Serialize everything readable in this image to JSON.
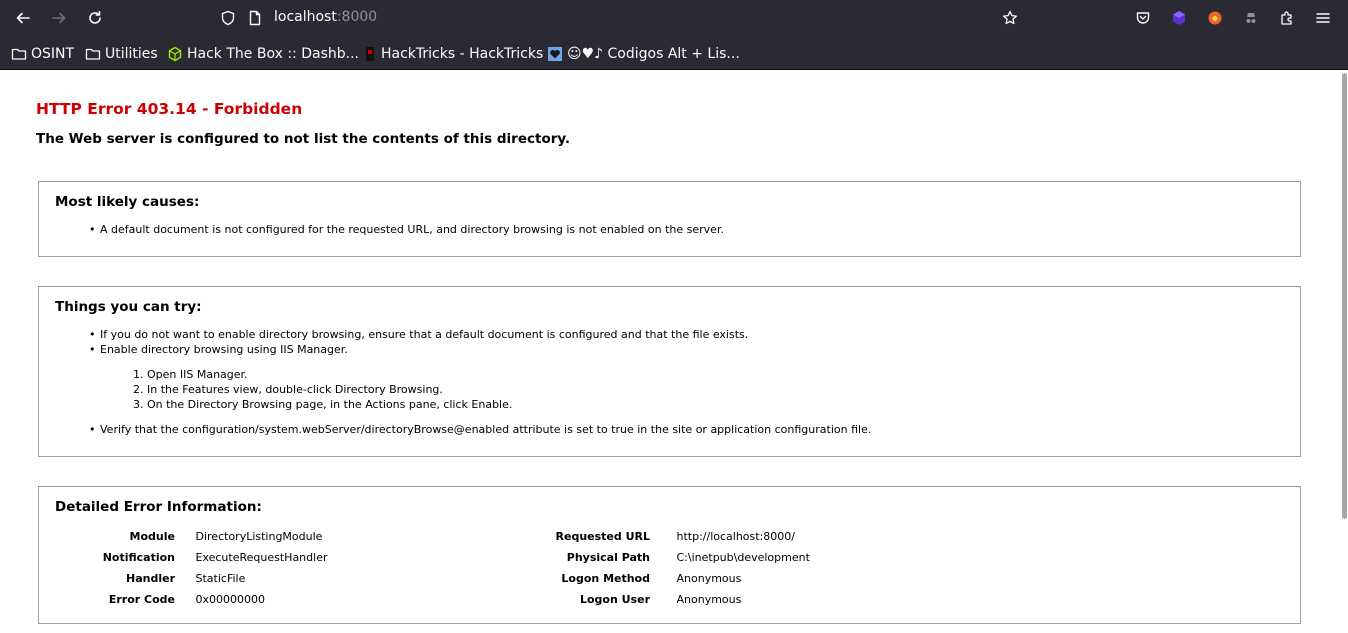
{
  "browser": {
    "url_host": "localhost",
    "url_port": ":8000",
    "bookmarks": [
      {
        "label": "OSINT",
        "icon": "folder-icon"
      },
      {
        "label": "Utilities",
        "icon": "folder-icon"
      },
      {
        "label": "Hack The Box :: Dashb...",
        "icon": "htb-cube-icon"
      },
      {
        "label": "HackTricks - HackTricks",
        "icon": "hacktricks-icon"
      },
      {
        "label": "☺♥♪ Codigos Alt + Lis...",
        "icon": "heart-favicon-icon"
      }
    ],
    "colors": {
      "chrome_bg": "#2b2a33",
      "text": "#fbfbfe",
      "port": "#8f8f9d"
    }
  },
  "error": {
    "title": "HTTP Error 403.14 - Forbidden",
    "subtitle": "The Web server is configured to not list the contents of this directory.",
    "title_color": "#cc0000"
  },
  "causes": {
    "heading": "Most likely causes:",
    "items": [
      "A default document is not configured for the requested URL, and directory browsing is not enabled on the server."
    ]
  },
  "try": {
    "heading": "Things you can try:",
    "item1": "If you do not want to enable directory browsing, ensure that a default document is configured and that the file exists.",
    "item2": "Enable directory browsing using IIS Manager.",
    "steps": [
      "1. Open IIS Manager.",
      "2. In the Features view, double-click Directory Browsing.",
      "3. On the Directory Browsing page, in the Actions pane, click Enable."
    ],
    "item3": "Verify that the configuration/system.webServer/directoryBrowse@enabled attribute is set to true in the site or application configuration file."
  },
  "details": {
    "heading": "Detailed Error Information:",
    "left": [
      {
        "key": "Module",
        "value": "DirectoryListingModule"
      },
      {
        "key": "Notification",
        "value": "ExecuteRequestHandler"
      },
      {
        "key": "Handler",
        "value": "StaticFile"
      },
      {
        "key": "Error Code",
        "value": "0x00000000"
      }
    ],
    "right": [
      {
        "key": "Requested URL",
        "value": "http://localhost:8000/"
      },
      {
        "key": "Physical Path",
        "value": "C:\\inetpub\\development"
      },
      {
        "key": "Logon Method",
        "value": "Anonymous"
      },
      {
        "key": "Logon User",
        "value": "Anonymous"
      }
    ]
  }
}
